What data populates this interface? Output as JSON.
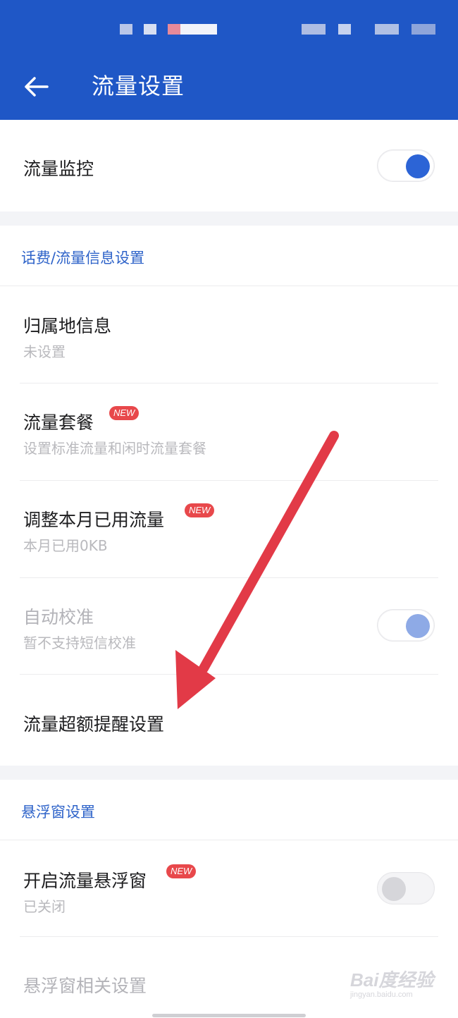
{
  "header": {
    "title": "流量设置",
    "back_icon": "arrow-left-icon",
    "background": "#1f57c6"
  },
  "monitor": {
    "label": "流量监控",
    "toggle_on": true
  },
  "section_billing": {
    "label": "话费/流量信息设置",
    "items": [
      {
        "title": "归属地信息",
        "subtitle": "未设置"
      },
      {
        "title": "流量套餐",
        "badge": "NEW",
        "subtitle": "设置标准流量和闲时流量套餐"
      },
      {
        "title": "调整本月已用流量",
        "badge": "NEW",
        "subtitle": "本月已用0KB"
      },
      {
        "title": "自动校准",
        "subtitle": "暂不支持短信校准",
        "disabled": true,
        "toggle_on": true
      },
      {
        "title": "流量超额提醒设置"
      }
    ]
  },
  "section_float": {
    "label": "悬浮窗设置",
    "items": [
      {
        "title": "开启流量悬浮窗",
        "badge": "NEW",
        "subtitle": "已关闭",
        "toggle_on": false
      },
      {
        "title": "悬浮窗相关设置",
        "disabled": true
      }
    ]
  },
  "annotation": {
    "type": "red-arrow",
    "color": "#e23a47",
    "points_to": "流量超额提醒设置"
  },
  "watermark": {
    "main": "Bai度经验",
    "sub": "jingyan.baidu.com"
  },
  "colors": {
    "accent": "#2c64d6",
    "section_label": "#2e63c9",
    "badge": "#e8484b"
  }
}
